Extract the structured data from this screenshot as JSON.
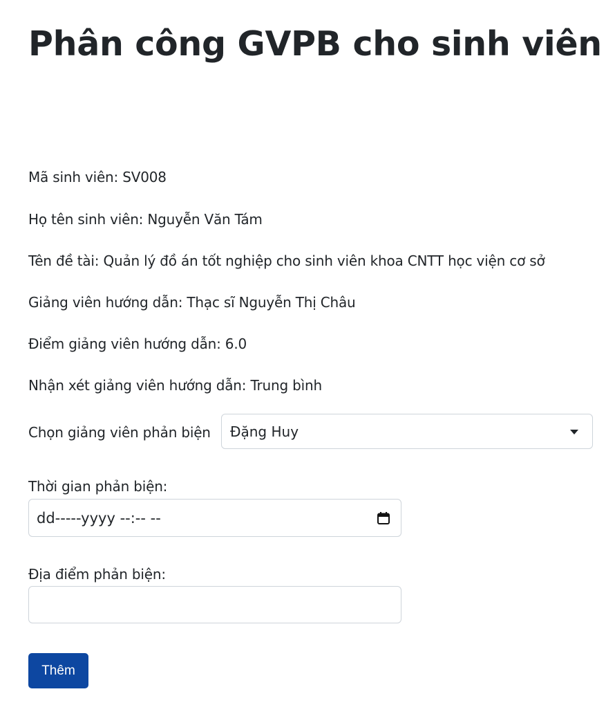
{
  "page": {
    "title": "Phân công GVPB cho sinh viên"
  },
  "student_info": {
    "student_id": "Mã sinh viên: SV008",
    "student_name": "Họ tên sinh viên: Nguyễn Văn Tám",
    "topic": "Tên đề tài: Quản lý đồ án tốt nghiệp cho sinh viên khoa CNTT học viện cơ sở",
    "advisor": "Giảng viên hướng dẫn: Thạc sĩ Nguyễn Thị Châu",
    "advisor_score": "Điểm giảng viên hướng dẫn: 6.0",
    "advisor_comment": "Nhận xét giảng viên hướng dẫn: Trung bình"
  },
  "form": {
    "reviewer_label": "Chọn giảng viên phản biện",
    "reviewer_selected": "Đặng Huy",
    "time_label": "Thời gian phản biện:",
    "time_value": "dd-----yyyy --:-- --",
    "location_label": "Địa điểm phản biện:",
    "location_value": "",
    "submit_label": "Thêm"
  },
  "icons": {
    "select_arrow": "chevron-down-icon",
    "calendar": "calendar-icon"
  },
  "colors": {
    "primary_button": "#0d47a1",
    "text": "#212529",
    "border": "#ced4da"
  }
}
